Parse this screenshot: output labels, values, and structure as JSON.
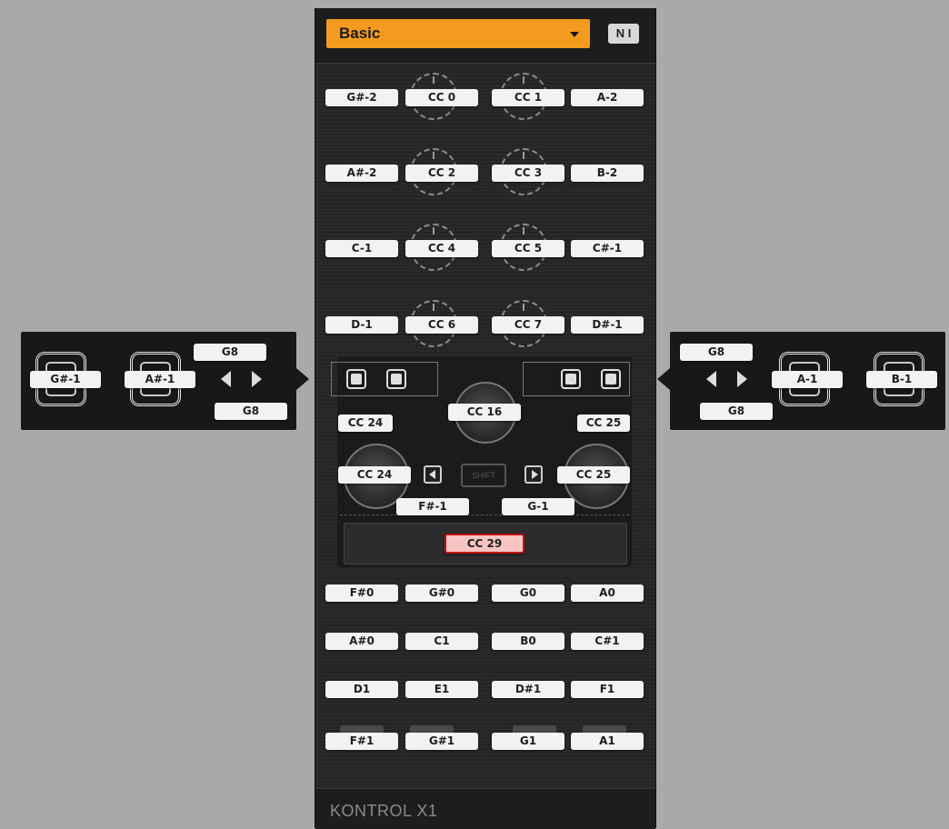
{
  "preset": {
    "label": "Basic"
  },
  "logo": {
    "text": "N I"
  },
  "device_name": "KONTROL X1",
  "knob_rows": [
    [
      "G#-2",
      "CC 0",
      "CC 1",
      "A-2"
    ],
    [
      "A#-2",
      "CC 2",
      "CC 3",
      "B-2"
    ],
    [
      "C-1",
      "CC 4",
      "CC 5",
      "C#-1"
    ],
    [
      "D-1",
      "CC 6",
      "CC 7",
      "D#-1"
    ]
  ],
  "left_panel": {
    "pad1": "G#-1",
    "pad2": "A#-1",
    "nav_top": "G8",
    "nav_bottom": "G8"
  },
  "right_panel": {
    "pad1": "A-1",
    "pad2": "B-1",
    "nav_top": "G8",
    "nav_bottom": "G8"
  },
  "center": {
    "display_left": "CC 24",
    "display_right": "CC 25",
    "top_knob": "CC 16",
    "left_knob": "CC 24",
    "right_knob": "CC 25",
    "prev_button": "F#-1",
    "next_button": "G-1",
    "shift_label": "SHIFT",
    "touchstrip": "CC 29"
  },
  "button_rows": [
    [
      "F#0",
      "G#0",
      "G0",
      "A0"
    ],
    [
      "A#0",
      "C1",
      "B0",
      "C#1"
    ],
    [
      "D1",
      "E1",
      "D#1",
      "F1"
    ],
    [
      "F#1",
      "G#1",
      "G1",
      "A1"
    ]
  ],
  "colors": {
    "accent": "#f49a1f",
    "background": "#a9a9a9",
    "device": "#262626",
    "highlight_border": "#c41010"
  }
}
